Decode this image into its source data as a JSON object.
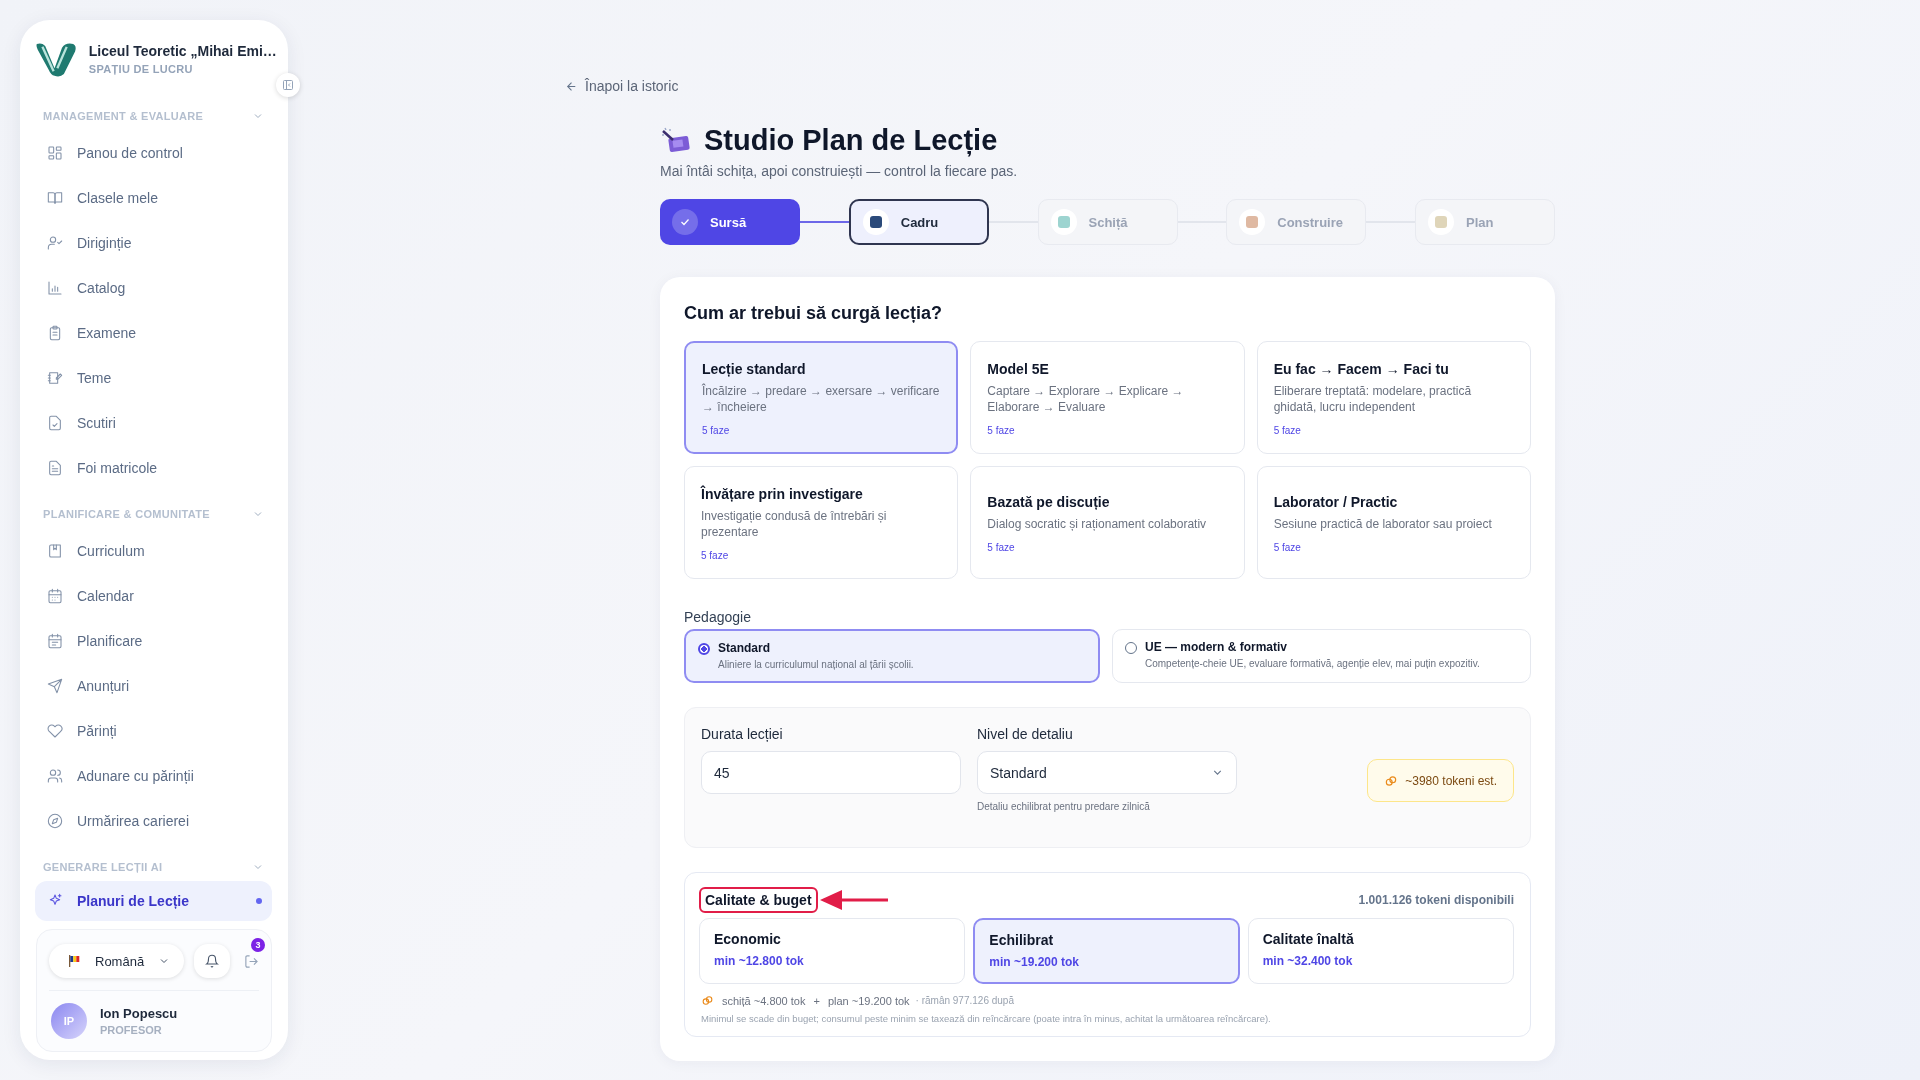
{
  "sidebar": {
    "school": "Liceul Teoretic „Mihai Emi…",
    "workspace": "SPAȚIU DE LUCRU",
    "sections": [
      {
        "title": "MANAGEMENT & EVALUARE",
        "expanded": true,
        "items": [
          {
            "label": "Panou de control",
            "selected": false
          },
          {
            "label": "Clasele mele",
            "selected": false
          },
          {
            "label": "Diriginție",
            "selected": false
          },
          {
            "label": "Catalog",
            "selected": false
          },
          {
            "label": "Examene",
            "selected": false
          },
          {
            "label": "Teme",
            "selected": false
          },
          {
            "label": "Scutiri",
            "selected": false
          },
          {
            "label": "Foi matricole",
            "selected": false
          }
        ]
      },
      {
        "title": "PLANIFICARE & COMUNITATE",
        "expanded": true,
        "items": [
          {
            "label": "Curriculum",
            "selected": false
          },
          {
            "label": "Calendar",
            "selected": false
          },
          {
            "label": "Planificare",
            "selected": false
          },
          {
            "label": "Anunțuri",
            "selected": false
          },
          {
            "label": "Părinți",
            "selected": false
          },
          {
            "label": "Adunare cu părinții",
            "selected": false
          },
          {
            "label": "Urmărirea carierei",
            "selected": false
          }
        ]
      },
      {
        "title": "GENERARE LECȚII AI",
        "expanded": true,
        "items": [
          {
            "label": "Planuri de Lecție",
            "selected": true
          }
        ]
      }
    ],
    "language": "Română",
    "notifications": "3",
    "user": {
      "initials": "IP",
      "name": "Ion Popescu",
      "role": "PROFESOR"
    }
  },
  "back_link": "Înapoi la istoric",
  "title": "Studio Plan de Lecție",
  "subtitle": "Mai întâi schița, apoi construiești — control la fiecare pas.",
  "steps": [
    {
      "label": "Sursă",
      "done": true,
      "selected": false
    },
    {
      "label": "Cadru",
      "done": false,
      "selected": true
    },
    {
      "label": "Schiță",
      "done": false,
      "selected": false
    },
    {
      "label": "Construire",
      "done": false,
      "selected": false
    },
    {
      "label": "Plan",
      "done": false,
      "selected": false
    }
  ],
  "flow": {
    "question": "Cum ar trebui să curgă lecția?",
    "options": [
      {
        "title": "Lecție standard",
        "description": "Încălzire → predare → exersare → verificare → încheiere",
        "phases": "5 faze",
        "selected": true
      },
      {
        "title": "Model 5E",
        "description": "Captare → Explorare → Explicare → Elaborare → Evaluare",
        "phases": "5 faze",
        "selected": false
      },
      {
        "title": "Eu fac → Facem → Faci tu",
        "description": "Eliberare treptată: modelare, practică ghidată, lucru independent",
        "phases": "5 faze",
        "selected": false
      },
      {
        "title": "Învățare prin investigare",
        "description": "Investigație condusă de întrebări și prezentare",
        "phases": "5 faze",
        "selected": false
      },
      {
        "title": "Bazată pe discuție",
        "description": "Dialog socratic și raționament colaborativ",
        "phases": "5 faze",
        "selected": false
      },
      {
        "title": "Laborator / Practic",
        "description": "Sesiune practică de laborator sau proiect",
        "phases": "5 faze",
        "selected": false
      }
    ]
  },
  "pedagogy": {
    "label": "Pedagogie",
    "options": [
      {
        "title": "Standard",
        "description": "Aliniere la curriculumul național al țării școlii.",
        "selected": true
      },
      {
        "title": "UE — modern & formativ",
        "description": "Competențe-cheie UE, evaluare formativă, agenție elev, mai puțin expozitiv.",
        "selected": false
      }
    ]
  },
  "duration": {
    "label": "Durata lecției",
    "value": "45"
  },
  "detail": {
    "label": "Nivel de detaliu",
    "value": "Standard",
    "hint": "Detaliu echilibrat pentru predare zilnică"
  },
  "token_estimate": "~3980 tokeni est.",
  "quality": {
    "title": "Calitate & buget",
    "highlighted": true,
    "available": "1.001.126 tokeni disponibili",
    "options": [
      {
        "title": "Economic",
        "minimum": "min ~12.800 tok",
        "selected": false
      },
      {
        "title": "Echilibrat",
        "minimum": "min ~19.200 tok",
        "selected": true
      },
      {
        "title": "Calitate înaltă",
        "minimum": "min ~32.400 tok",
        "selected": false
      }
    ],
    "breakdown": [
      "schiță ~4.800 tok",
      "+",
      "plan ~19.200 tok",
      "· rămân 977.126 după"
    ],
    "note": "Minimul se scade din buget; consumul peste minim se taxează din reîncărcare (poate intra în minus, achitat la următoarea reîncărcare)."
  }
}
